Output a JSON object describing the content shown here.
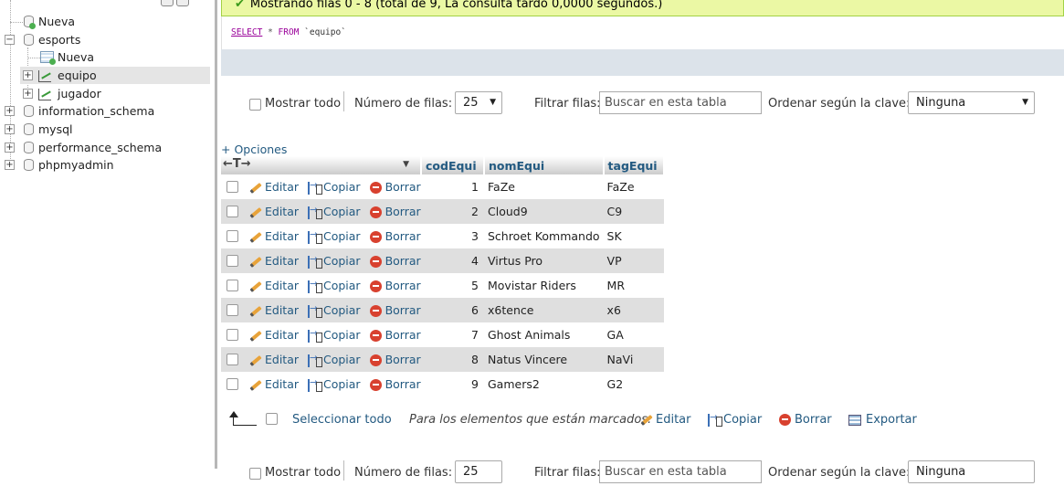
{
  "nav": {
    "items": [
      {
        "label": "Nueva"
      },
      {
        "label": "esports"
      },
      {
        "label": "Nueva"
      },
      {
        "label": "equipo"
      },
      {
        "label": "jugador"
      },
      {
        "label": "information_schema"
      },
      {
        "label": "mysql"
      },
      {
        "label": "performance_schema"
      },
      {
        "label": "phpmyadmin"
      }
    ]
  },
  "message": "Mostrando filas 0 - 8 (total de 9, La consulta tardó 0,0000 segundos.)",
  "sql": {
    "select": "SELECT",
    "star": "*",
    "from": "FROM",
    "table": "`equipo`"
  },
  "controls": {
    "show_all": "Mostrar todo",
    "rows_label": "Número de filas:",
    "rows_value": "25",
    "filter_label": "Filtrar filas:",
    "filter_placeholder": "Buscar en esta tabla",
    "sort_label": "Ordenar según la clave:",
    "sort_value": "Ninguna"
  },
  "controls_bottom": {
    "show_all": "Mostrar todo",
    "rows_label": "Número de filas:",
    "rows_value": "25",
    "filter_label": "Filtrar filas:",
    "filter_placeholder": "Buscar en esta tabla",
    "sort_label": "Ordenar según la clave:",
    "sort_value": "Ninguna"
  },
  "options_link": "+ Opciones",
  "table": {
    "columns": [
      "codEqui",
      "nomEqui",
      "tagEqui"
    ],
    "actions": {
      "edit": "Editar",
      "copy": "Copiar",
      "delete": "Borrar"
    },
    "rows": [
      {
        "cod": "1",
        "nom": "FaZe",
        "tag": "FaZe"
      },
      {
        "cod": "2",
        "nom": "Cloud9",
        "tag": "C9"
      },
      {
        "cod": "3",
        "nom": "Schroet Kommando",
        "tag": "SK"
      },
      {
        "cod": "4",
        "nom": "Virtus Pro",
        "tag": "VP"
      },
      {
        "cod": "5",
        "nom": "Movistar Riders",
        "tag": "MR"
      },
      {
        "cod": "6",
        "nom": "x6tence",
        "tag": "x6"
      },
      {
        "cod": "7",
        "nom": "Ghost Animals",
        "tag": "GA"
      },
      {
        "cod": "8",
        "nom": "Natus Vincere",
        "tag": "NaVi"
      },
      {
        "cod": "9",
        "nom": "Gamers2",
        "tag": "G2"
      }
    ]
  },
  "bulk": {
    "select_all": "Seleccionar todo",
    "marked_label": "Para los elementos que están marcados:",
    "edit": "Editar",
    "copy": "Copiar",
    "delete": "Borrar",
    "export": "Exportar"
  }
}
